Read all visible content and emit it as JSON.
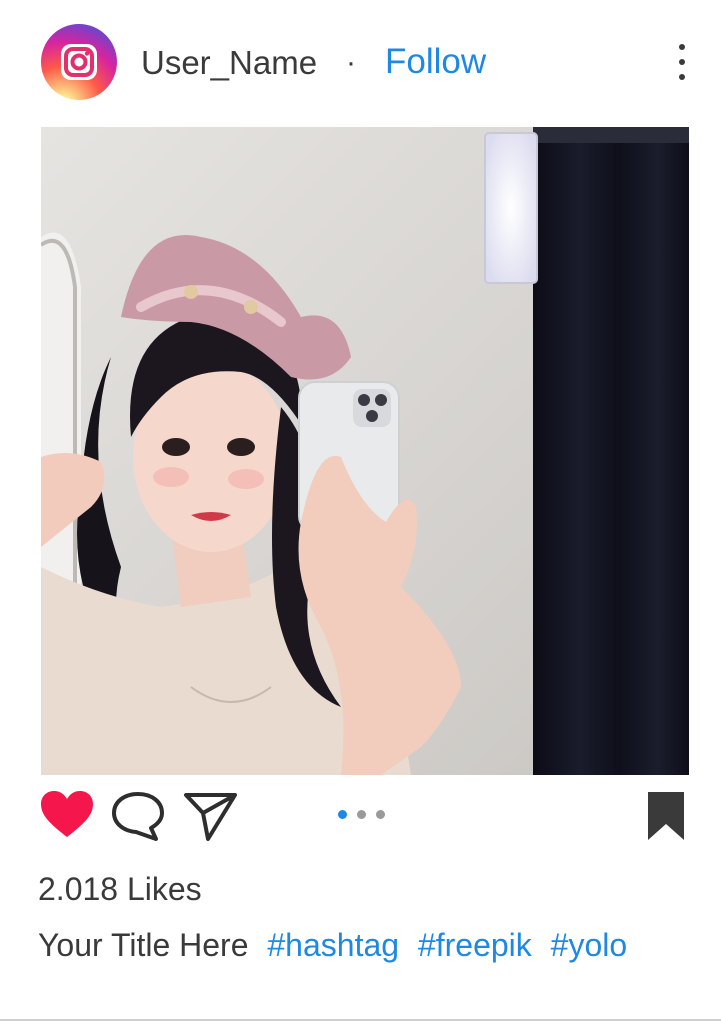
{
  "post": {
    "username": "User_Name",
    "separator": "·",
    "follow_label": "Follow",
    "likes_text": "2.018 Likes",
    "title": "Your Title Here",
    "hashtags": [
      "#hashtag",
      "#freepik",
      "#yolo"
    ],
    "carousel": {
      "count": 3,
      "active_index": 0
    }
  },
  "colors": {
    "follow_blue": "#1e88e5",
    "heart_red": "#f5174b",
    "text_dark": "#3a3a3a",
    "dot_active": "#1e88e5",
    "dot_inactive": "#9a9a9a"
  },
  "icons": {
    "avatar": "instagram-logo-icon",
    "more": "vertical-dots-icon",
    "like": "heart-filled-icon",
    "comment": "speech-bubble-icon",
    "share": "paper-plane-icon",
    "save": "bookmark-filled-icon"
  }
}
